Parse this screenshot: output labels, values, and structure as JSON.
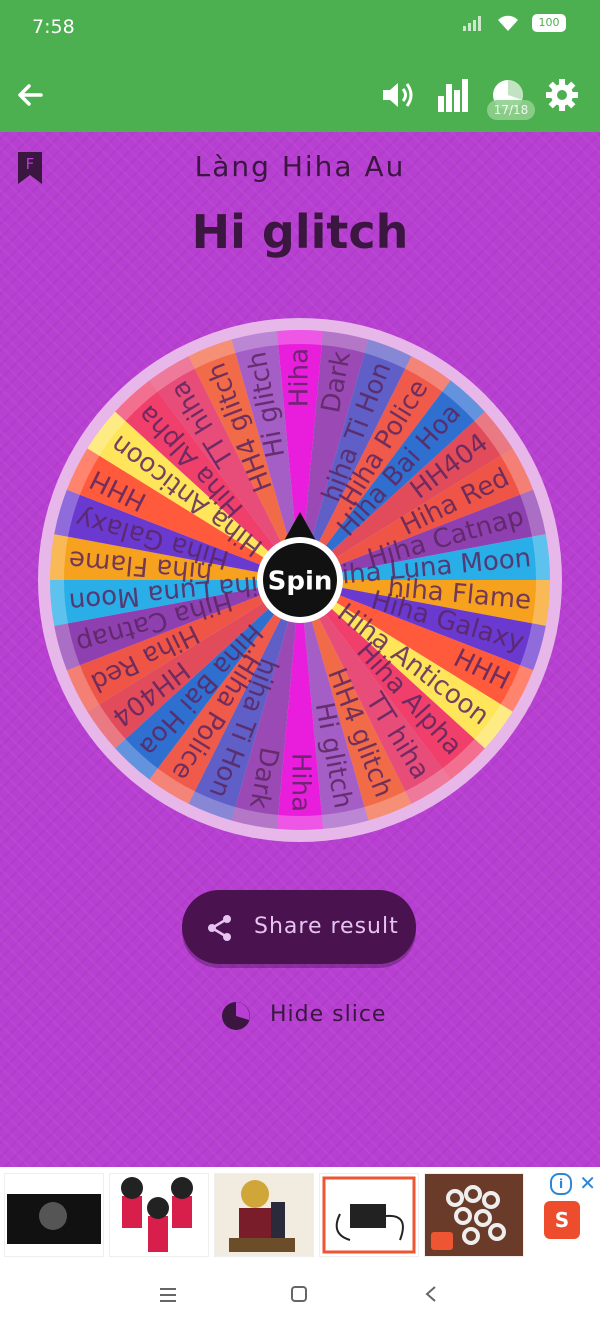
{
  "status": {
    "time": "7:58",
    "battery": "100"
  },
  "toolbar": {
    "pie_counter": "17/18"
  },
  "page": {
    "village": "Làng Hiha Au",
    "title": "Hi glitch",
    "bookmark_letter": "F"
  },
  "wheel": {
    "center_label": "Spin",
    "slices": [
      "Hiha",
      "Dark",
      "hiha Ti Hon",
      "Hiha Police",
      "Hiha Bai Hoa",
      "HH404",
      "Hiha Red",
      "Hiha Catnap",
      "Hiha Luna Moon",
      "hiha Flame",
      "Hiha Galaxy",
      "HHH",
      "Hiha Anticoon",
      "Hiha Alpha",
      "TT hiha",
      "HH4 glitch",
      "Hi glitch",
      "Hiha",
      "Dark",
      "hiha Ti Hon",
      "Hiha Police",
      "Hiha Bai Hoa",
      "HH404",
      "Hiha Red",
      "Hiha Catnap",
      "Hiha Luna Moon",
      "hiha Flame",
      "Hiha Galaxy",
      "HHH",
      "Hiha Anticoon",
      "Hiha Alpha",
      "TT hiha",
      "HH4 glitch",
      "Hi glitch"
    ],
    "colors": [
      "#e91edc",
      "#9b49b4",
      "#5f5fc7",
      "#f05a4b",
      "#2f6fd0",
      "#e24c5a",
      "#ef5547",
      "#8e3fb0",
      "#29aee8",
      "#f7a21e",
      "#6a3ad0",
      "#ff5a3c",
      "#ffe55a",
      "#ef3f6a",
      "#e84d7a",
      "#f26b48",
      "#a55ec5"
    ]
  },
  "actions": {
    "share_label": "Share result",
    "hide_label": "Hide slice"
  },
  "ad": {
    "shopee_glyph": "S",
    "info_glyph": "i",
    "close_glyph": "✕"
  }
}
